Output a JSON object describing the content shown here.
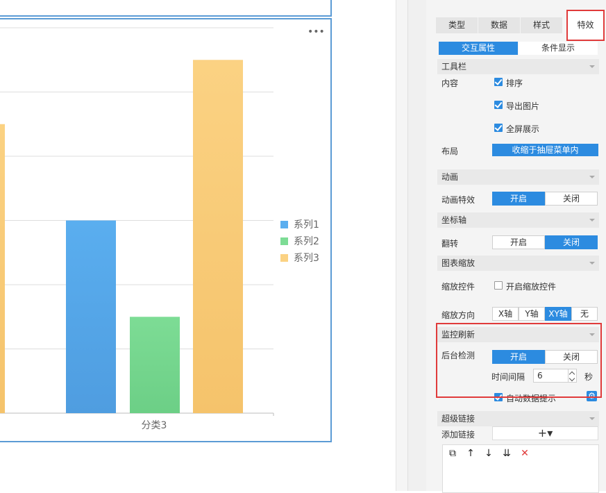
{
  "chart": {
    "legend": [
      "系列1",
      "系列2",
      "系列3"
    ],
    "more_icon": "more-dots-icon",
    "colors": {
      "series1": "#5aaeef",
      "series2": "#7ddc95",
      "series3": "#fbd283"
    }
  },
  "chart_data": {
    "type": "bar",
    "categories": [
      "分类3"
    ],
    "series": [
      {
        "name": "系列1",
        "values": [
          3
        ]
      },
      {
        "name": "系列2",
        "values": [
          1.5
        ]
      },
      {
        "name": "系列3",
        "values": [
          5.5
        ]
      }
    ],
    "partial_bar_left_value": 4.5,
    "ylim": [
      0,
      6
    ],
    "grid": true,
    "legend_position": "right"
  },
  "tabs": {
    "main": [
      "类型",
      "数据",
      "样式",
      "特效"
    ],
    "active_main": "特效",
    "sub": [
      "交互属性",
      "条件显示"
    ],
    "active_sub": "交互属性"
  },
  "toolbar": {
    "title": "工具栏",
    "content_label": "内容",
    "items": [
      "排序",
      "导出图片",
      "全屏展示"
    ],
    "layout_label": "布局",
    "layout_value": "收缩于抽屉菜单内"
  },
  "animation": {
    "title": "动画",
    "label": "动画特效",
    "on": "开启",
    "off": "关闭"
  },
  "axis": {
    "title": "坐标轴",
    "label": "翻转",
    "on": "开启",
    "off": "关闭"
  },
  "zoom": {
    "title": "图表缩放",
    "control_label": "缩放控件",
    "control_option": "开启缩放控件",
    "direction_label": "缩放方向",
    "directions": [
      "X轴",
      "Y轴",
      "XY轴",
      "无"
    ],
    "active_direction": "XY轴"
  },
  "monitor": {
    "title": "监控刷新",
    "label": "后台检测",
    "on": "开启",
    "off": "关闭",
    "interval_label": "时间间隔",
    "interval_value": "6",
    "interval_unit": "秒",
    "auto_tip": "自动数据提示"
  },
  "hyperlink": {
    "title": "超级链接",
    "add_label": "添加链接",
    "add_icon": "+▾"
  }
}
